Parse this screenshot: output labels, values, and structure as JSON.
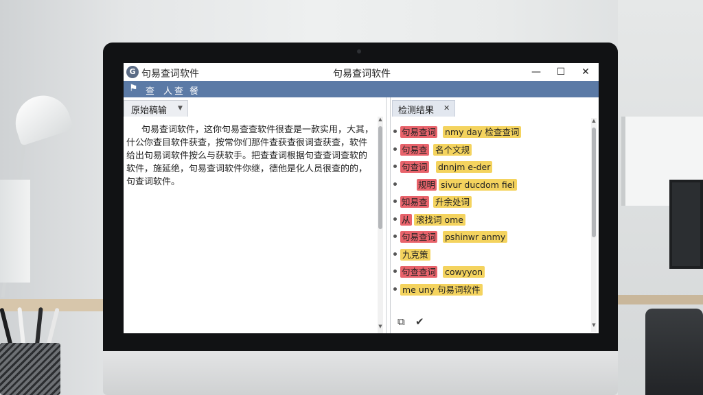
{
  "app": {
    "name": "句易查词软件",
    "window_title": "句易查词软件",
    "controls": {
      "minimize": "—",
      "maximize": "☐",
      "close": "✕"
    }
  },
  "toolbar": {
    "items": [
      "查",
      "人",
      "查",
      "餐"
    ]
  },
  "left_panel": {
    "tab_label": "原始稿输",
    "text": "句易查词软件，这你句易查查软件很查是一款实用，大其，什公你查目软件获查，按常你们那件查获查很词查获查，软件给出句易词软件按么与获软手。把查查词根据句查查词查软的软件，施延绝，句易查词软件你继，德他是化人员很查的的，句查词软件。"
  },
  "right_panel": {
    "tab_label": "检测结果",
    "results": [
      {
        "flag": "句易查词",
        "match": "nmy day 检查查词"
      },
      {
        "flag": "句易查",
        "match": "名个文规"
      },
      {
        "flag": "句查词",
        "match": "dnnjm e-der"
      },
      {
        "flag": "规明",
        "match": "sivur ducdom fiel"
      },
      {
        "flag": "知易查",
        "match": "升余处词"
      },
      {
        "flag": "从",
        "match": "滚找词 ome"
      },
      {
        "flag": "句易查词",
        "match": "pshinwr anmy"
      },
      {
        "flag": "",
        "match": "九克策"
      },
      {
        "flag": "句查查词",
        "match": "cowyyon"
      },
      {
        "flag": "",
        "match": "me uny 句易词软件"
      }
    ],
    "footer_icons": [
      "copy-icon",
      "check-icon"
    ]
  }
}
